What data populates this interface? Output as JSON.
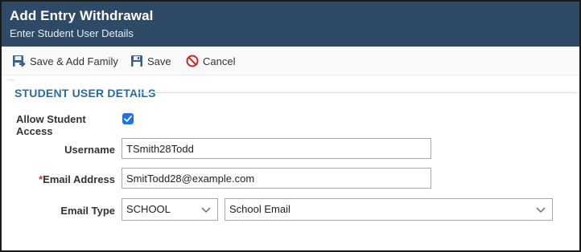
{
  "window": {
    "title": "Add Entry Withdrawal",
    "subtitle": "Enter Student User Details"
  },
  "toolbar": {
    "save_add_family_label": "Save & Add Family",
    "save_label": "Save",
    "cancel_label": "Cancel"
  },
  "section": {
    "title": "STUDENT USER DETAILS"
  },
  "form": {
    "allow_access_label": "Allow Student Access",
    "allow_access_checked": true,
    "username_label": "Username",
    "username_value": "TSmith28Todd",
    "email_required_marker": "*",
    "email_label": "Email Address",
    "email_value": "SmitTodd28@example.com",
    "email_type_label": "Email Type",
    "email_type_selected": "SCHOOL",
    "email_kind_selected": "School Email"
  },
  "colors": {
    "header_bg": "#2e4a66",
    "section_title": "#2e6a99",
    "checkbox": "#1a73e8",
    "cancel_icon": "#c62828",
    "save_icon": "#3b5f8a"
  },
  "icons": {
    "save_add_family": "save-arrow-icon",
    "save": "floppy-disk-icon",
    "cancel": "no-entry-circle-icon",
    "dropdown": "chevron-down-icon",
    "checkbox": "check-icon"
  }
}
